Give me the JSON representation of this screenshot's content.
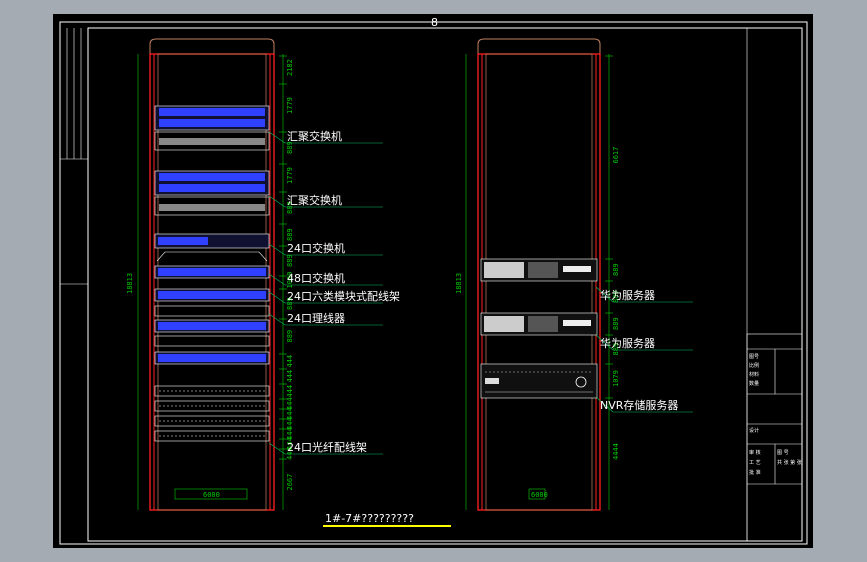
{
  "drawing": {
    "caption": "1#-7#?????????",
    "top_marker": "8"
  },
  "left_cabinet": {
    "labels": [
      "汇聚交换机",
      "汇聚交换机",
      "24口交换机",
      "48口交换机",
      "24口六类模块式配线架",
      "24口理线器",
      "24口光纤配线架"
    ],
    "dimensions": [
      "2182",
      "1779",
      "889",
      "1779",
      "889",
      "889",
      "889",
      "1000",
      "889",
      "889",
      "444",
      "444",
      "444",
      "444",
      "444",
      "444",
      "444",
      "444",
      "444",
      "2667"
    ],
    "height_dim": "18813",
    "width_dim": "6000"
  },
  "right_cabinet": {
    "labels": [
      "华为服务器",
      "华为服务器",
      "NVR存储服务器"
    ],
    "dimensions": [
      "6617",
      "889",
      "889",
      "889",
      "889",
      "1079",
      "4444"
    ],
    "height_dim": "18813",
    "bottom_tag": "6000"
  },
  "title_block": {
    "rows": [
      "图号",
      "比例",
      "材料",
      "数量"
    ],
    "section": "设计",
    "sub": [
      "审 核",
      "工 艺",
      "批 准"
    ],
    "extra": [
      "图 号",
      "共 张 第 张"
    ]
  },
  "colors": {
    "frame": "#ffffff",
    "cabinet": "#ff2020",
    "cabinet_inner": "#c08060",
    "blue_device": "#3040ff",
    "dimension": "#00d000",
    "leader": "#00c060",
    "caption_underline": "#ffff00"
  }
}
